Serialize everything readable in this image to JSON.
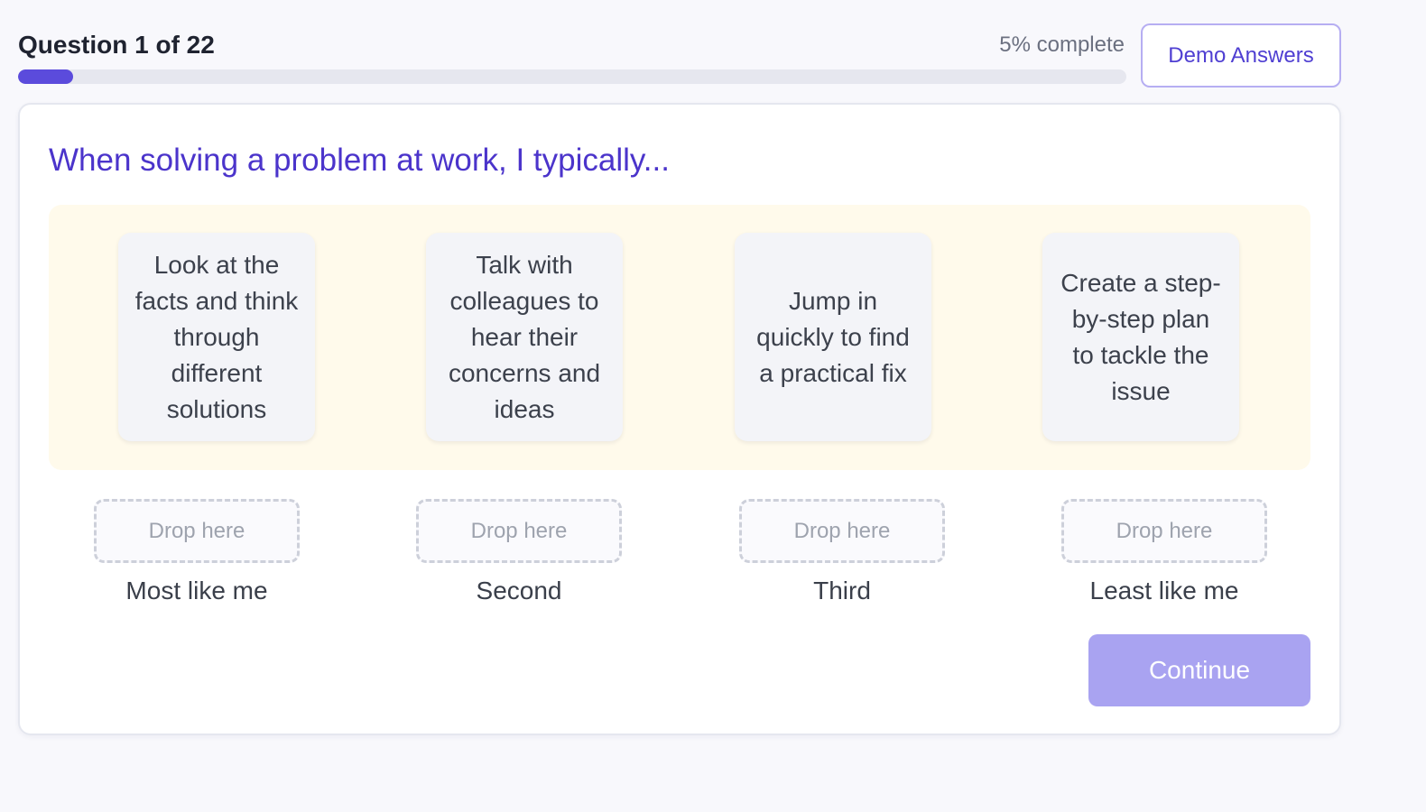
{
  "header": {
    "question_counter": "Question 1 of 22",
    "progress_label": "5% complete",
    "progress_fraction": 0.05,
    "demo_button_label": "Demo Answers"
  },
  "question": {
    "prompt": "When solving a problem at work, I typically..."
  },
  "options": [
    {
      "text": "Look at the facts and think through different solutions"
    },
    {
      "text": "Talk with colleagues to hear their concerns and ideas"
    },
    {
      "text": "Jump in quickly to find a practical fix"
    },
    {
      "text": "Create a step-by-step plan to tackle the issue"
    }
  ],
  "rank_slots": [
    {
      "placeholder": "Drop here",
      "label": "Most like me"
    },
    {
      "placeholder": "Drop here",
      "label": "Second"
    },
    {
      "placeholder": "Drop here",
      "label": "Third"
    },
    {
      "placeholder": "Drop here",
      "label": "Least like me"
    }
  ],
  "actions": {
    "continue_label": "Continue",
    "continue_disabled": true
  },
  "colors": {
    "accent": "#5b4bdc",
    "question_text": "#4b34cb",
    "options_background": "#fffaeb",
    "continue_disabled": "#a9a3f1"
  }
}
